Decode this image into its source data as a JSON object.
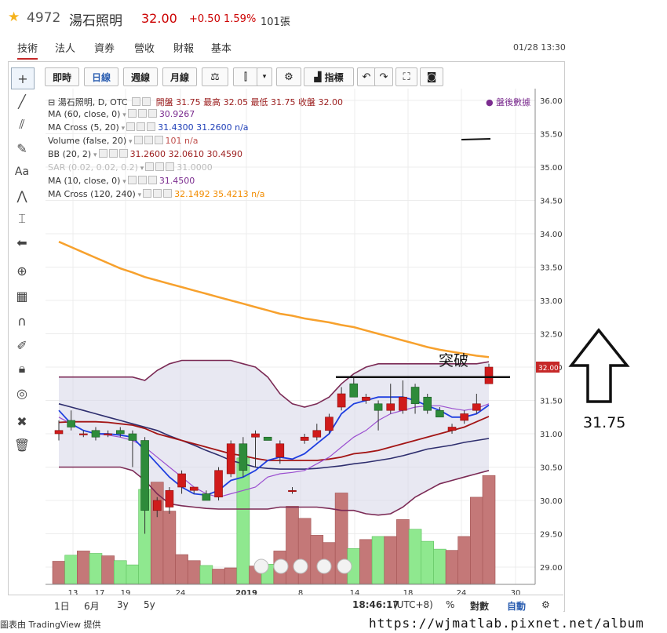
{
  "header": {
    "code": "4972",
    "name": "湯石照明",
    "price": "32.00",
    "change": "+0.50",
    "pct": "1.59%",
    "volume": "101張"
  },
  "tabs": [
    {
      "label": "技術"
    },
    {
      "label": "法人"
    },
    {
      "label": "資券"
    },
    {
      "label": "營收"
    },
    {
      "label": "財報"
    },
    {
      "label": "基本"
    }
  ],
  "datetime": "01/28 13:30",
  "toolbar": {
    "intraday": "即時",
    "daily": "日線",
    "weekly": "週線",
    "monthly": "月線",
    "indicators": "指標"
  },
  "legend": {
    "main_title": "湯石照明, D, OTC",
    "ohlc": "開盤 31.75 最高 32.05 最低 31.75 收盤 32.00",
    "after_hours": "盤後數據",
    "rows": [
      {
        "title": "MA (60, close, 0)",
        "values": "30.9267",
        "color": "#7b2c8f"
      },
      {
        "title": "MA Cross (5, 20)",
        "values": "31.4300 31.2600 n/a",
        "color": "#1f3fb8"
      },
      {
        "title": "Volume (false, 20)",
        "values": "101 n/a",
        "color": "#c0504d"
      },
      {
        "title": "BB (20, 2)",
        "values": "31.2600 32.0610 30.4590",
        "color": "#9b1c1c"
      },
      {
        "title": "SAR (0.02, 0.02, 0.2)",
        "values": "31.0000",
        "color": "#bbbbbb"
      },
      {
        "title": "MA (10, close, 0)",
        "values": "31.4500",
        "color": "#7b2c8f"
      },
      {
        "title": "MA Cross (120, 240)",
        "values": "32.1492 35.4213 n/a",
        "color": "#f28c00"
      }
    ]
  },
  "annotation": {
    "label": "突破",
    "side_value": "31.75"
  },
  "bottom_bar": {
    "ranges": [
      "1日",
      "6月",
      "3y",
      "5y"
    ],
    "time": "18:46:17",
    "tz": "(UTC+8)",
    "pct": "%",
    "log": "對數",
    "auto": "自動"
  },
  "watermark": "https://wjmatlab.pixnet.net/album",
  "credit": "圖表由 TradingView 提供",
  "chart_data": {
    "type": "candlestick",
    "x_tick_labels": [
      "13",
      "17",
      "19",
      "24",
      "2019",
      "8",
      "14",
      "18",
      "24",
      "30"
    ],
    "ylim": [
      28.75,
      36.15
    ],
    "y_ticks": [
      29.0,
      29.5,
      30.0,
      30.5,
      31.0,
      31.5,
      32.0,
      32.5,
      33.0,
      33.5,
      34.0,
      34.5,
      35.0,
      35.5,
      36.0
    ],
    "last_price_label": "32.00",
    "candles": [
      {
        "o": 31.0,
        "h": 31.2,
        "l": 30.9,
        "c": 31.05
      },
      {
        "o": 31.2,
        "h": 31.35,
        "l": 31.05,
        "c": 31.1
      },
      {
        "o": 31.0,
        "h": 31.05,
        "l": 30.95,
        "c": 31.0
      },
      {
        "o": 31.05,
        "h": 31.1,
        "l": 30.9,
        "c": 30.95
      },
      {
        "o": 31.0,
        "h": 31.05,
        "l": 30.95,
        "c": 31.0
      },
      {
        "o": 31.05,
        "h": 31.1,
        "l": 30.95,
        "c": 31.0
      },
      {
        "o": 31.0,
        "h": 31.05,
        "l": 30.5,
        "c": 30.9
      },
      {
        "o": 30.9,
        "h": 30.95,
        "l": 29.5,
        "c": 29.85
      },
      {
        "o": 29.85,
        "h": 30.05,
        "l": 29.75,
        "c": 30.0
      },
      {
        "o": 29.9,
        "h": 30.2,
        "l": 29.8,
        "c": 30.15
      },
      {
        "o": 30.2,
        "h": 30.45,
        "l": 30.1,
        "c": 30.4
      },
      {
        "o": 30.15,
        "h": 30.2,
        "l": 30.1,
        "c": 30.2
      },
      {
        "o": 30.1,
        "h": 30.15,
        "l": 30.0,
        "c": 30.0
      },
      {
        "o": 30.05,
        "h": 30.5,
        "l": 30.0,
        "c": 30.45
      },
      {
        "o": 30.4,
        "h": 30.9,
        "l": 30.35,
        "c": 30.85
      },
      {
        "o": 30.85,
        "h": 30.95,
        "l": 30.35,
        "c": 30.45
      },
      {
        "o": 30.95,
        "h": 31.05,
        "l": 30.5,
        "c": 31.0
      },
      {
        "o": 30.95,
        "h": 30.95,
        "l": 30.9,
        "c": 30.9
      },
      {
        "o": 30.65,
        "h": 30.9,
        "l": 30.55,
        "c": 30.85
      },
      {
        "o": 30.15,
        "h": 30.2,
        "l": 30.1,
        "c": 30.15
      },
      {
        "o": 30.9,
        "h": 31.0,
        "l": 30.85,
        "c": 30.95
      },
      {
        "o": 30.95,
        "h": 31.15,
        "l": 30.9,
        "c": 31.05
      },
      {
        "o": 31.05,
        "h": 31.3,
        "l": 31.0,
        "c": 31.25
      },
      {
        "o": 31.4,
        "h": 31.7,
        "l": 31.35,
        "c": 31.6
      },
      {
        "o": 31.75,
        "h": 31.85,
        "l": 31.6,
        "c": 31.55
      },
      {
        "o": 31.5,
        "h": 31.6,
        "l": 31.45,
        "c": 31.55
      },
      {
        "o": 31.45,
        "h": 31.5,
        "l": 31.05,
        "c": 31.35
      },
      {
        "o": 31.35,
        "h": 31.75,
        "l": 31.3,
        "c": 31.45
      },
      {
        "o": 31.35,
        "h": 31.8,
        "l": 31.3,
        "c": 31.55
      },
      {
        "o": 31.7,
        "h": 31.75,
        "l": 31.3,
        "c": 31.45
      },
      {
        "o": 31.55,
        "h": 31.6,
        "l": 31.3,
        "c": 31.35
      },
      {
        "o": 31.35,
        "h": 31.4,
        "l": 31.25,
        "c": 31.25
      },
      {
        "o": 31.05,
        "h": 31.15,
        "l": 31.0,
        "c": 31.1
      },
      {
        "o": 31.2,
        "h": 31.35,
        "l": 31.15,
        "c": 31.3
      },
      {
        "o": 31.35,
        "h": 31.6,
        "l": 31.3,
        "c": 31.45
      },
      {
        "o": 31.75,
        "h": 32.05,
        "l": 31.75,
        "c": 32.0
      }
    ],
    "volumes": [
      37,
      47,
      54,
      50,
      46,
      38,
      31,
      156,
      168,
      120,
      48,
      38,
      30,
      24,
      26,
      208,
      29,
      32,
      54,
      128,
      108,
      80,
      68,
      150,
      58,
      73,
      78,
      78,
      106,
      90,
      70,
      57,
      55,
      78,
      143,
      179
    ],
    "bb_upper": [
      31.85,
      31.85,
      31.85,
      31.85,
      31.85,
      31.85,
      31.85,
      31.8,
      31.95,
      32.05,
      32.1,
      32.1,
      32.1,
      32.1,
      32.1,
      32.05,
      32.0,
      31.85,
      31.6,
      31.45,
      31.4,
      31.45,
      31.55,
      31.75,
      31.9,
      32.0,
      32.05,
      32.05,
      32.05,
      32.05,
      32.05,
      32.05,
      32.05,
      32.05,
      32.05,
      32.08
    ],
    "bb_lower": [
      30.5,
      30.5,
      30.5,
      30.5,
      30.5,
      30.5,
      30.45,
      30.3,
      30.1,
      29.95,
      29.92,
      29.9,
      29.88,
      29.87,
      29.87,
      29.87,
      29.87,
      29.87,
      29.9,
      29.9,
      29.9,
      29.9,
      29.88,
      29.85,
      29.85,
      29.8,
      29.78,
      29.8,
      29.9,
      30.05,
      30.15,
      30.25,
      30.3,
      30.35,
      30.4,
      30.45
    ],
    "ma20": [
      31.17,
      31.18,
      31.18,
      31.18,
      31.17,
      31.15,
      31.13,
      31.08,
      31.0,
      30.95,
      30.9,
      30.85,
      30.8,
      30.75,
      30.7,
      30.67,
      30.63,
      30.6,
      30.6,
      30.6,
      30.6,
      30.6,
      30.62,
      30.65,
      30.7,
      30.72,
      30.75,
      30.8,
      30.85,
      30.9,
      30.95,
      31.0,
      31.05,
      31.1,
      31.18,
      31.26
    ],
    "ma60": [
      31.45,
      31.4,
      31.35,
      31.3,
      31.25,
      31.2,
      31.15,
      31.1,
      31.05,
      30.97,
      30.9,
      30.83,
      30.75,
      30.68,
      30.6,
      30.55,
      30.5,
      30.48,
      30.47,
      30.47,
      30.47,
      30.48,
      30.5,
      30.52,
      30.55,
      30.57,
      30.6,
      30.63,
      30.67,
      30.72,
      30.77,
      30.8,
      30.83,
      30.87,
      30.9,
      30.93
    ],
    "ma5": [
      31.35,
      31.15,
      31.05,
      31.0,
      31.0,
      30.98,
      30.95,
      30.75,
      30.55,
      30.35,
      30.2,
      30.1,
      30.08,
      30.15,
      30.3,
      30.35,
      30.45,
      30.6,
      30.65,
      30.62,
      30.7,
      30.85,
      31.0,
      31.3,
      31.45,
      31.5,
      31.55,
      31.55,
      31.55,
      31.5,
      31.42,
      31.35,
      31.25,
      31.25,
      31.3,
      31.43
    ],
    "ma10": [
      31.25,
      31.15,
      31.05,
      31.0,
      30.98,
      30.95,
      30.9,
      30.8,
      30.65,
      30.5,
      30.35,
      30.2,
      30.1,
      30.05,
      30.1,
      30.15,
      30.2,
      30.35,
      30.4,
      30.42,
      30.45,
      30.55,
      30.65,
      30.8,
      30.95,
      31.05,
      31.2,
      31.3,
      31.35,
      31.4,
      31.42,
      31.42,
      31.38,
      31.35,
      31.38,
      31.45
    ],
    "ma120": [
      33.88,
      33.8,
      33.72,
      33.64,
      33.56,
      33.48,
      33.42,
      33.35,
      33.3,
      33.25,
      33.2,
      33.15,
      33.1,
      33.05,
      33.0,
      32.95,
      32.9,
      32.85,
      32.8,
      32.77,
      32.73,
      32.7,
      32.67,
      32.63,
      32.6,
      32.55,
      32.5,
      32.45,
      32.4,
      32.35,
      32.3,
      32.26,
      32.23,
      32.2,
      32.17,
      32.15
    ],
    "breakout_level": 31.85
  }
}
